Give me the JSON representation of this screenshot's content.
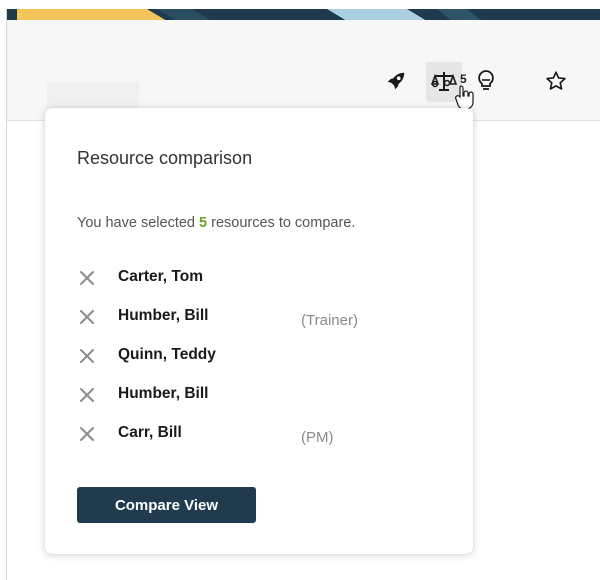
{
  "toolbar": {
    "icons": [
      {
        "name": "rocket-icon"
      },
      {
        "name": "scales-compare-icon",
        "badge": "5"
      },
      {
        "name": "lightbulb-icon"
      },
      {
        "name": "star-icon"
      }
    ]
  },
  "popover": {
    "title": "Resource comparison",
    "description_prefix": "You have selected ",
    "selected_count": "5",
    "description_suffix": " resources to compare.",
    "resources": [
      {
        "name": "Carter, Tom",
        "role": ""
      },
      {
        "name": "Humber, Bill",
        "role": "(Trainer)"
      },
      {
        "name": "Quinn, Teddy",
        "role": ""
      },
      {
        "name": "Humber, Bill",
        "role": ""
      },
      {
        "name": "Carr, Bill",
        "role": "(PM)"
      }
    ],
    "compare_button_label": "Compare View"
  },
  "colors": {
    "accent_green": "#6aa32a",
    "button_bg": "#1f3b4d",
    "banner_navy": "#1e3a4c",
    "banner_yellow": "#f2c45a",
    "banner_lightblue": "#a9cfe0"
  }
}
